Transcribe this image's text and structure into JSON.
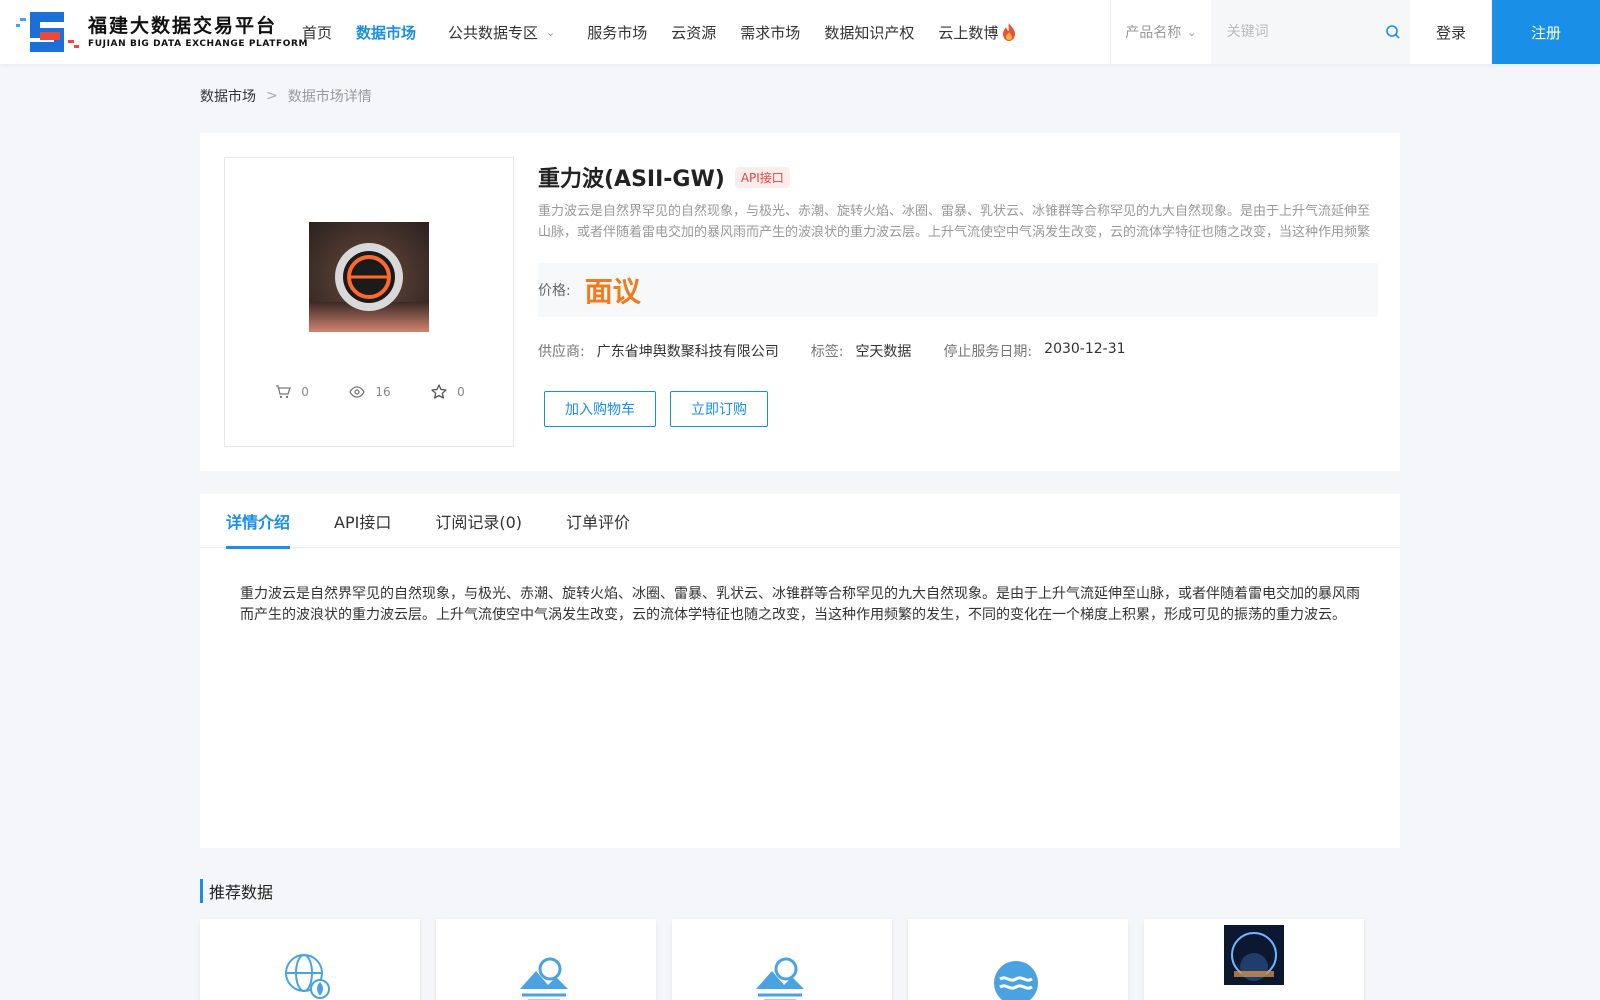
{
  "header": {
    "logo_cn": "福建大数据交易平台",
    "logo_en": "FUJIAN BIG DATA EXCHANGE PLATFORM",
    "nav": [
      {
        "label": "首页",
        "active": false
      },
      {
        "label": "数据市场",
        "active": true
      },
      {
        "label": "公共数据专区",
        "active": false,
        "dropdown": true
      },
      {
        "label": "服务市场",
        "active": false
      },
      {
        "label": "云资源",
        "active": false
      },
      {
        "label": "需求市场",
        "active": false
      },
      {
        "label": "数据知识产权",
        "active": false
      },
      {
        "label": "云上数博",
        "active": false,
        "hot": true
      }
    ],
    "search_type": "产品名称",
    "search_placeholder": "关键词",
    "login": "登录",
    "register": "注册"
  },
  "breadcrumb": {
    "parent": "数据市场",
    "separator": ">",
    "current": "数据市场详情"
  },
  "product": {
    "title": "重力波(ASII-GW)",
    "badge": "API接口",
    "description": "重力波云是自然界罕见的自然现象，与极光、赤潮、旋转火焰、冰圈、雷暴、乳状云、冰锥群等合称罕见的九大自然现象。是由于上升气流延伸至山脉，或者伴随着雷电交加的暴风雨而产生的波浪状的重力波云层。上升气流使空中气涡发生改变，云的流体学特征也随之改变，当这种作用频繁的发生，不同的变化在一个梯度上积累，形成可见的振荡的重力波云。",
    "price_label": "价格:",
    "price_value": "面议",
    "supplier_label": "供应商:",
    "supplier_value": "广东省坤舆数聚科技有限公司",
    "tag_label": "标签:",
    "tag_value": "空天数据",
    "stop_label": "停止服务日期:",
    "stop_value": "2030-12-31",
    "stats": {
      "cart": "0",
      "views": "16",
      "favorites": "0"
    },
    "add_cart": "加入购物车",
    "subscribe": "立即订购"
  },
  "tabs": [
    {
      "label": "详情介绍",
      "active": true
    },
    {
      "label": "API接口",
      "active": false
    },
    {
      "label": "订阅记录(0)",
      "active": false
    },
    {
      "label": "订单评价",
      "active": false
    }
  ],
  "detail_text": "重力波云是自然界罕见的自然现象，与极光、赤潮、旋转火焰、冰圈、雷暴、乳状云、冰锥群等合称罕见的九大自然现象。是由于上升气流延伸至山脉，或者伴随着雷电交加的暴风雨而产生的波浪状的重力波云层。上升气流使空中气涡发生改变，云的流体学特征也随之改变，当这种作用频繁的发生，不同的变化在一个梯度上积累，形成可见的振荡的重力波云。",
  "recommend": {
    "title": "推荐数据",
    "items": [
      {
        "icon": "globe-leaf-icon"
      },
      {
        "icon": "sun-mountain-icon"
      },
      {
        "icon": "sun-mountain-icon"
      },
      {
        "icon": "wave-circle-icon"
      },
      {
        "icon": "earth-photo-icon"
      }
    ]
  },
  "colors": {
    "accent": "#1a8fe8",
    "price": "#f07a1c",
    "badge": "#e54545"
  }
}
